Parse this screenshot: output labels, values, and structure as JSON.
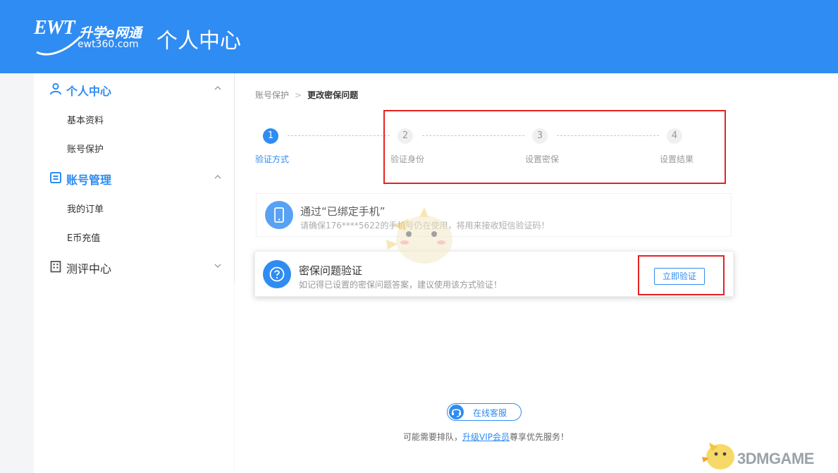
{
  "header": {
    "logo_ewt": "EWT",
    "logo_cn": "升学e网通",
    "logo_sub": "ewt360.com",
    "title": "个人中心"
  },
  "sidebar": {
    "groups": [
      {
        "label": "个人中心",
        "icon": "user-icon",
        "expanded": true,
        "items": [
          "基本资料",
          "账号保护"
        ]
      },
      {
        "label": "账号管理",
        "icon": "list-icon",
        "expanded": true,
        "items": [
          "我的订单",
          "E币充值"
        ]
      },
      {
        "label": "测评中心",
        "icon": "building-icon",
        "expanded": false,
        "items": []
      }
    ]
  },
  "breadcrumb": {
    "parent": "账号保护",
    "separator": ">",
    "current": "更改密保问题"
  },
  "steps": [
    {
      "number": "1",
      "label": "验证方式",
      "status": "active"
    },
    {
      "number": "2",
      "label": "验证身份",
      "status": "todo"
    },
    {
      "number": "3",
      "label": "设置密保",
      "status": "todo"
    },
    {
      "number": "4",
      "label": "设置结果",
      "status": "todo"
    }
  ],
  "methods": [
    {
      "title": "通过“已绑定手机”",
      "desc": "请确保176****5622的手机号仍在使用，将用来接收短信验证码！",
      "icon": "phone-icon"
    },
    {
      "title": "密保问题验证",
      "desc": "如记得已设置的密保问题答案，建议使用该方式验证！",
      "icon": "question-icon",
      "button": "立即验证"
    }
  ],
  "service": {
    "button": "在线客服",
    "note_prefix": "可能需要排队，",
    "note_link": "升级VIP会员",
    "note_suffix": "尊享优先服务！"
  },
  "watermark": "3DMGAME",
  "colors": {
    "brand": "#2f8cf2",
    "highlight": "#e52222"
  }
}
